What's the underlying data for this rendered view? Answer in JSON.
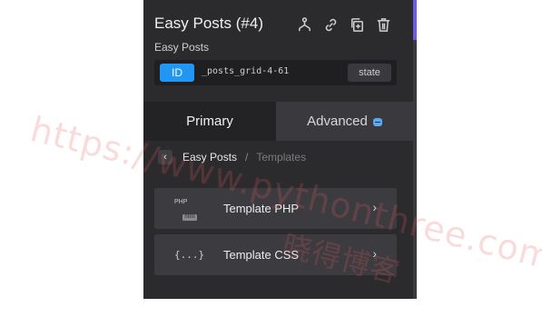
{
  "element": {
    "title": "Easy Posts (#4)",
    "subtitle": "Easy Posts",
    "id_badge": "ID",
    "id_value": "_posts_grid-4-61",
    "state_label": "state"
  },
  "toolbar": {
    "icons": [
      "sitemap-icon",
      "link-icon",
      "duplicate-icon",
      "trash-icon"
    ]
  },
  "tabs": {
    "primary": "Primary",
    "advanced": "Advanced"
  },
  "breadcrumb": {
    "back": "‹",
    "current": "Easy Posts",
    "separator": "/",
    "section": "Templates"
  },
  "templates": [
    {
      "icon": "php-html-icon",
      "icon_top": "PHP",
      "icon_bottom": "html",
      "label": "Template PHP",
      "chevron": "›"
    },
    {
      "icon": "css-braces-icon",
      "icon_text": "{...}",
      "label": "Template CSS",
      "chevron": "›"
    }
  ],
  "watermark": {
    "line1": "https://www.pythonthree.com",
    "line2": "晓得博客"
  },
  "colors": {
    "panel": "#2b2b2e",
    "id_badge": "#2196f3",
    "accent": "#6c5ce7",
    "advanced_dot": "#5aa9f2"
  }
}
